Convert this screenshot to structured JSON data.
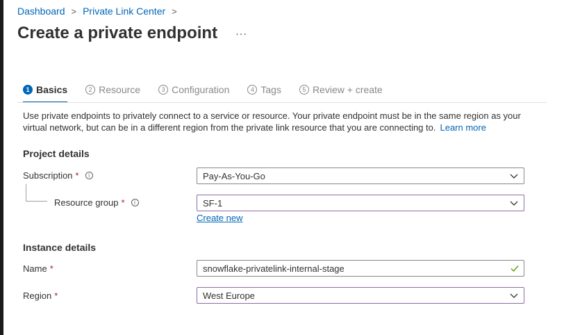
{
  "breadcrumb": {
    "items": [
      "Dashboard",
      "Private Link Center"
    ],
    "separator": ">"
  },
  "page": {
    "title": "Create a private endpoint",
    "more": "···"
  },
  "tabs": [
    {
      "num": "1",
      "label": "Basics",
      "active": true
    },
    {
      "num": "2",
      "label": "Resource",
      "active": false
    },
    {
      "num": "3",
      "label": "Configuration",
      "active": false
    },
    {
      "num": "4",
      "label": "Tags",
      "active": false
    },
    {
      "num": "5",
      "label": "Review + create",
      "active": false
    }
  ],
  "intro": {
    "text": "Use private endpoints to privately connect to a service or resource. Your private endpoint must be in the same region as your virtual network, but can be in a different region from the private link resource that you are connecting to.",
    "link": "Learn more"
  },
  "project": {
    "heading": "Project details",
    "subscription": {
      "label": "Subscription",
      "required": "*",
      "value": "Pay-As-You-Go"
    },
    "resource_group": {
      "label": "Resource group",
      "required": "*",
      "value": "SF-1",
      "create_new": "Create new"
    }
  },
  "instance": {
    "heading": "Instance details",
    "name": {
      "label": "Name",
      "required": "*",
      "value": "snowflake-privatelink-internal-stage"
    },
    "region": {
      "label": "Region",
      "required": "*",
      "value": "West Europe"
    }
  },
  "icons": {
    "info": "i"
  },
  "colors": {
    "link": "#0066b8",
    "required": "#a4262c",
    "valid": "#57a300",
    "focus_border": "#8f6aa3"
  }
}
